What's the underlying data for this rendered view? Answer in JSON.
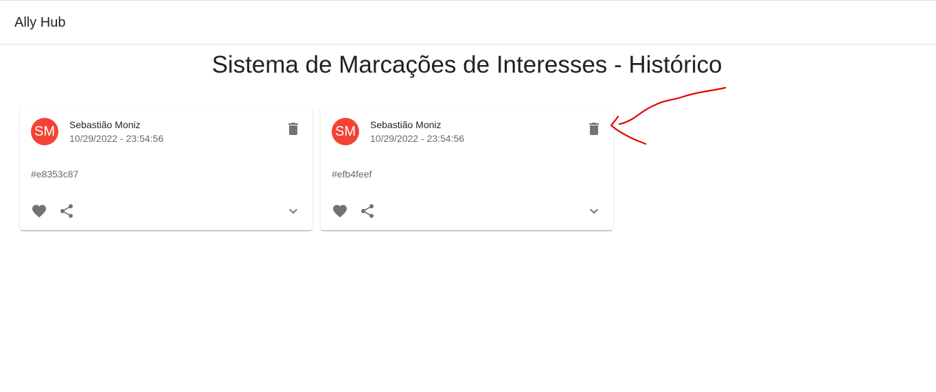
{
  "appbar": {
    "title": "Ally Hub"
  },
  "page": {
    "title": "Sistema de Marcações de Interesses - Histórico"
  },
  "cards": [
    {
      "avatar": "SM",
      "name": "Sebastião Moniz",
      "date": "10/29/2022 - 23:54:56",
      "content": "#e8353c87"
    },
    {
      "avatar": "SM",
      "name": "Sebastião Moniz",
      "date": "10/29/2022 - 23:54:56",
      "content": "#efb4feef"
    }
  ],
  "icons": {
    "delete": "trash-icon",
    "like": "heart-icon",
    "share": "share-icon",
    "expand": "chevron-down-icon"
  },
  "colors": {
    "avatar_bg": "#f44336",
    "icon": "#737373",
    "annotation": "#e00000"
  }
}
